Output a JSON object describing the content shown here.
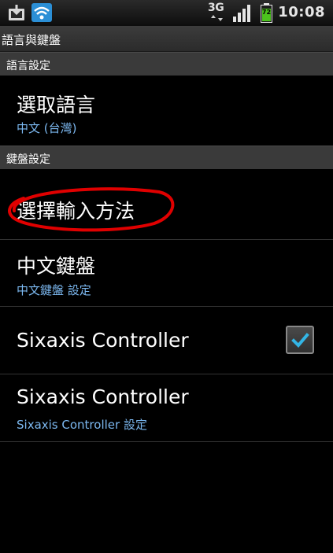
{
  "status_bar": {
    "network": "3G",
    "battery_level": "72",
    "time": "10:08",
    "icons": [
      "download-icon",
      "wifi-icon",
      "3g-icon",
      "signal-icon",
      "battery-icon"
    ]
  },
  "title_bar": {
    "title": "語言與鍵盤"
  },
  "sections": {
    "language": {
      "header": "語言設定",
      "select_language": {
        "title": "選取語言",
        "summary": "中文 (台灣)"
      }
    },
    "keyboard": {
      "header": "鍵盤設定",
      "input_method": {
        "title": "選擇輸入方法"
      },
      "chinese_keyboard": {
        "title": "中文鍵盤",
        "summary": "中文鍵盤 設定"
      },
      "sixaxis_toggle": {
        "title": "Sixaxis Controller",
        "checked": true
      },
      "sixaxis_settings": {
        "title": "Sixaxis Controller",
        "summary": "Sixaxis Controller 設定"
      }
    }
  },
  "colors": {
    "background": "#000000",
    "summary_text": "#7cb8f0",
    "annotation": "#e00000",
    "checkmark": "#33b5e5"
  }
}
